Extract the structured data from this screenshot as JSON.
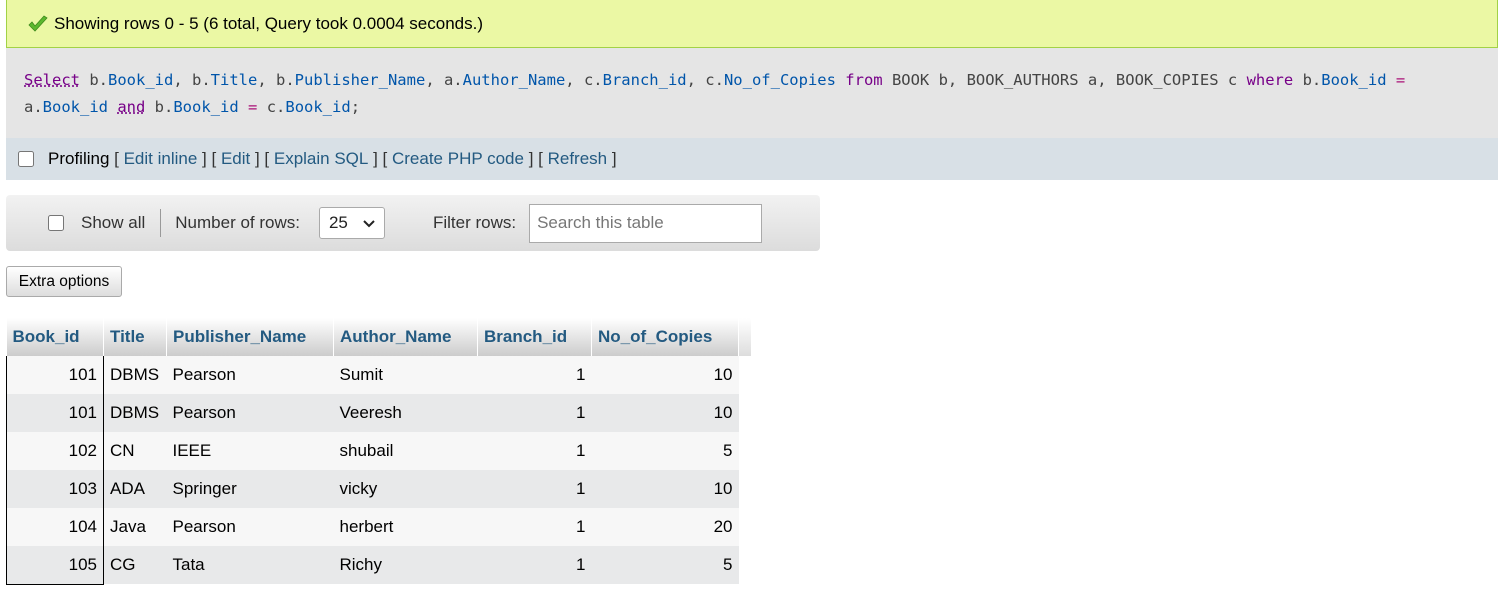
{
  "success": {
    "message": "Showing rows 0 - 5 (6 total, Query took 0.0004 seconds.)",
    "icon": "check-icon",
    "accent": "#5cb82e"
  },
  "sql": {
    "kw_select": "Select",
    "t1": " b.",
    "f1": "Book_id",
    "t2": ", b.",
    "f2": "Title",
    "t3": ", b.",
    "f3": "Publisher_Name",
    "t4": ", a.",
    "f4": "Author_Name",
    "t5": ", c.",
    "f5": "Branch_id",
    "t6": ", c.",
    "f6": "No_of_Copies",
    "kw_from": "from",
    "t7": " BOOK b, BOOK_AUTHORS a, BOOK_COPIES c ",
    "kw_where": "where",
    "t8": " b.",
    "f7": "Book_id",
    "eq1": "=",
    "t9": " a.",
    "f8": "Book_id",
    "kw_and": "and",
    "t10": " b.",
    "f9": "Book_id",
    "eq2": "=",
    "t11": " c.",
    "f10": "Book_id",
    "t12": ";"
  },
  "toolbar": {
    "profiling_label": "Profiling",
    "links": [
      "Edit inline",
      "Edit",
      "Explain SQL",
      "Create PHP code",
      "Refresh"
    ]
  },
  "nav": {
    "show_all_label": "Show all",
    "rows_label": "Number of rows:",
    "rows_value": "25",
    "filter_label": "Filter rows:",
    "filter_placeholder": "Search this table"
  },
  "extra_options_label": "Extra options",
  "table": {
    "columns": [
      "Book_id",
      "Title",
      "Publisher_Name",
      "Author_Name",
      "Branch_id",
      "No_of_Copies"
    ],
    "rows": [
      [
        "101",
        "DBMS",
        "Pearson",
        "Sumit",
        "1",
        "10"
      ],
      [
        "101",
        "DBMS",
        "Pearson",
        "Veeresh",
        "1",
        "10"
      ],
      [
        "102",
        "CN",
        "IEEE",
        "shubail",
        "1",
        "5"
      ],
      [
        "103",
        "ADA",
        "Springer",
        "vicky",
        "1",
        "10"
      ],
      [
        "104",
        "Java",
        "Pearson",
        "herbert",
        "1",
        "20"
      ],
      [
        "105",
        "CG",
        "Tata",
        "Richy",
        "1",
        "5"
      ]
    ]
  }
}
